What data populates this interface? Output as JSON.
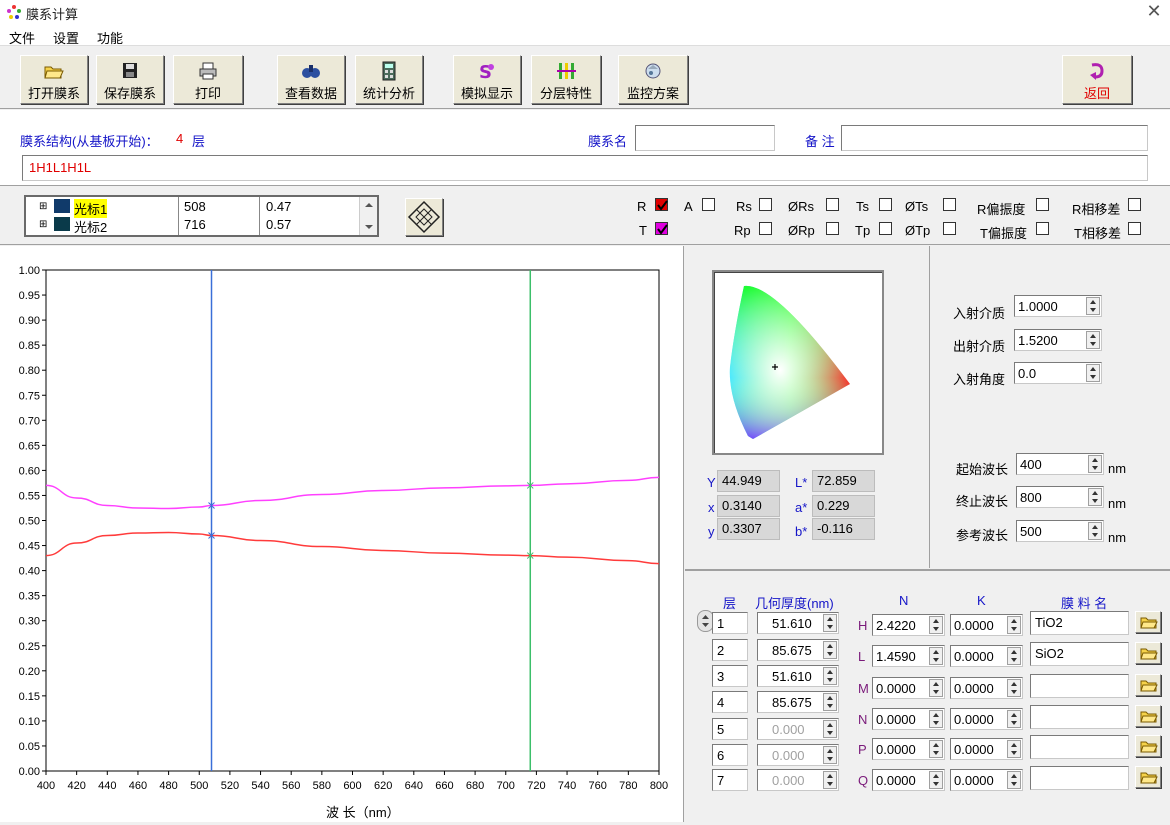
{
  "window": {
    "title": "膜系计算",
    "close_glyph": "✕"
  },
  "menu": [
    "文件",
    "设置",
    "功能"
  ],
  "toolbar": {
    "open": "打开膜系",
    "save": "保存膜系",
    "print": "打印",
    "view_data": "查看数据",
    "statistics": "统计分析",
    "simulate": "模拟显示",
    "layer_props": "分层特性",
    "monitor": "监控方案",
    "back": "返回"
  },
  "structure": {
    "label": "膜系结构(从基板开始)：",
    "layer_count": "4",
    "layer_unit": "层",
    "name_label": "膜系名",
    "name_value": "",
    "note_label": "备 注",
    "note_value": "",
    "formula": "1H1L1H1L"
  },
  "cursors": [
    {
      "name": "光标1",
      "wavelength": "508",
      "value": "0.47",
      "highlight": true
    },
    {
      "name": "光标2",
      "wavelength": "716",
      "value": "0.57",
      "highlight": false
    }
  ],
  "options": {
    "R": "R",
    "T": "T",
    "A": "A",
    "Rs": "Rs",
    "phiRs": "ØRs",
    "Ts": "Ts",
    "phiTs": "ØTs",
    "R_pol": "R偏振度",
    "R_phase": "R相移差",
    "Rp": "Rp",
    "phiRp": "ØRp",
    "Tp": "Tp",
    "phiTp": "ØTp",
    "T_pol": "T偏振度",
    "T_phase": "T相移差",
    "checked": {
      "R": true,
      "T": true
    }
  },
  "chart_data": {
    "type": "line",
    "xlabel": "波 长（nm）",
    "ylabel": "",
    "xlim": [
      400,
      800
    ],
    "ylim": [
      0,
      1
    ],
    "x_ticks": [
      "400",
      "420",
      "440",
      "460",
      "480",
      "500",
      "520",
      "540",
      "560",
      "580",
      "600",
      "620",
      "640",
      "660",
      "680",
      "700",
      "720",
      "740",
      "760",
      "780",
      "800"
    ],
    "y_ticks": [
      "0.00",
      "0.05",
      "0.10",
      "0.15",
      "0.20",
      "0.25",
      "0.30",
      "0.35",
      "0.40",
      "0.45",
      "0.50",
      "0.55",
      "0.60",
      "0.65",
      "0.70",
      "0.75",
      "0.80",
      "0.85",
      "0.90",
      "0.95",
      "1.00"
    ],
    "x": [
      400,
      420,
      440,
      460,
      480,
      500,
      508,
      540,
      580,
      620,
      660,
      700,
      716,
      740,
      780,
      800
    ],
    "series": [
      {
        "name": "R",
        "color": "#ff3b3b",
        "values": [
          0.43,
          0.455,
          0.47,
          0.475,
          0.476,
          0.473,
          0.47,
          0.46,
          0.448,
          0.44,
          0.435,
          0.431,
          0.43,
          0.427,
          0.42,
          0.414
        ]
      },
      {
        "name": "T",
        "color": "#ff40ff",
        "values": [
          0.57,
          0.545,
          0.53,
          0.525,
          0.524,
          0.527,
          0.53,
          0.54,
          0.552,
          0.56,
          0.565,
          0.569,
          0.57,
          0.573,
          0.58,
          0.586
        ]
      }
    ],
    "cursors": [
      {
        "x": 508,
        "color": "#3a6fd8"
      },
      {
        "x": 716,
        "color": "#3cbf6a"
      }
    ],
    "grid": false
  },
  "color": {
    "Y_label": "Y",
    "Y": "44.949",
    "x_label": "x",
    "x": "0.3140",
    "y_label": "y",
    "y": "0.3307",
    "L_label": "L*",
    "L": "72.859",
    "a_label": "a*",
    "a": "0.229",
    "b_label": "b*",
    "b": "-0.116"
  },
  "medium": {
    "incident_label": "入射介质",
    "incident": "1.0000",
    "exit_label": "出射介质",
    "exit": "1.5200",
    "angle_label": "入射角度",
    "angle": "0.0",
    "start_label": "起始波长",
    "start": "400",
    "end_label": "终止波长",
    "end": "800",
    "ref_label": "参考波长",
    "ref": "500",
    "unit": "nm"
  },
  "layers": {
    "hdr_layer": "层",
    "hdr_thick": "几何厚度(nm)",
    "hdr_n": "N",
    "hdr_k": "K",
    "hdr_mat": "膜 料 名",
    "rows": [
      {
        "no": "1",
        "thickness": "51.610",
        "active": true
      },
      {
        "no": "2",
        "thickness": "85.675",
        "active": true
      },
      {
        "no": "3",
        "thickness": "51.610",
        "active": true
      },
      {
        "no": "4",
        "thickness": "85.675",
        "active": true
      },
      {
        "no": "5",
        "thickness": "0.000",
        "active": false
      },
      {
        "no": "6",
        "thickness": "0.000",
        "active": false
      },
      {
        "no": "7",
        "thickness": "0.000",
        "active": false
      }
    ],
    "materials": [
      {
        "letter": "H",
        "n": "2.4220",
        "k": "0.0000",
        "name": "TiO2"
      },
      {
        "letter": "L",
        "n": "1.4590",
        "k": "0.0000",
        "name": "SiO2"
      },
      {
        "letter": "M",
        "n": "0.0000",
        "k": "0.0000",
        "name": ""
      },
      {
        "letter": "N",
        "n": "0.0000",
        "k": "0.0000",
        "name": ""
      },
      {
        "letter": "P",
        "n": "0.0000",
        "k": "0.0000",
        "name": ""
      },
      {
        "letter": "Q",
        "n": "0.0000",
        "k": "0.0000",
        "name": ""
      }
    ]
  }
}
